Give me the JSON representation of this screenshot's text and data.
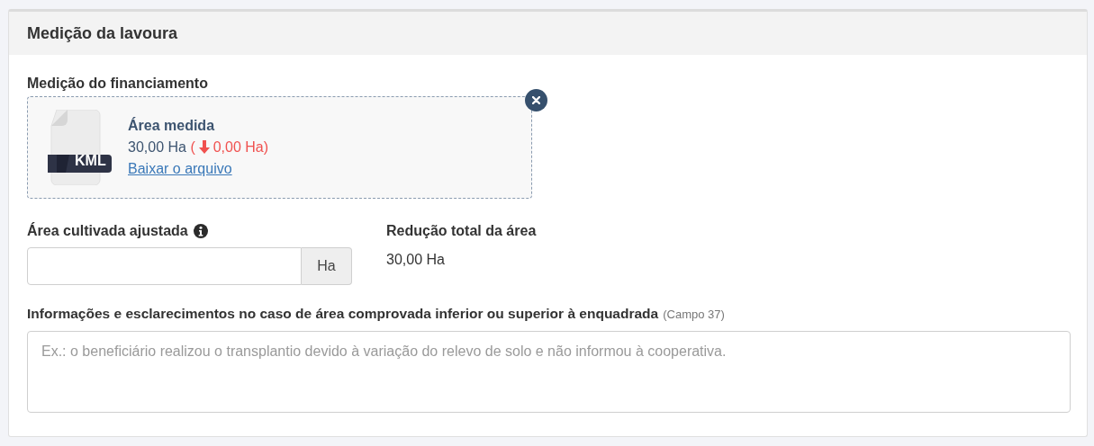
{
  "panel": {
    "title": "Medição da lavoura"
  },
  "file_measurement": {
    "label": "Medição do financiamento",
    "file_type": "KML",
    "title": "Área medida",
    "area": "30,00 Ha",
    "change_prefix": "(",
    "change": "0,00 Ha",
    "change_suffix": ")",
    "decreased": true,
    "link": "Baixar o arquivo"
  },
  "adjusted_area": {
    "label": "Área cultivada ajustada",
    "unit": "Ha"
  },
  "total_reduction": {
    "label": "Redução total da área",
    "value": "30,00 Ha"
  },
  "notes": {
    "label": "Informações e esclarecimentos no caso de área comprovada inferior ou superior à enquadrada",
    "hint": "(Campo 37)",
    "placeholder": "Ex.: o beneficiário realizou o transplantio devido à variação do relevo de solo e não informou à cooperativa."
  }
}
